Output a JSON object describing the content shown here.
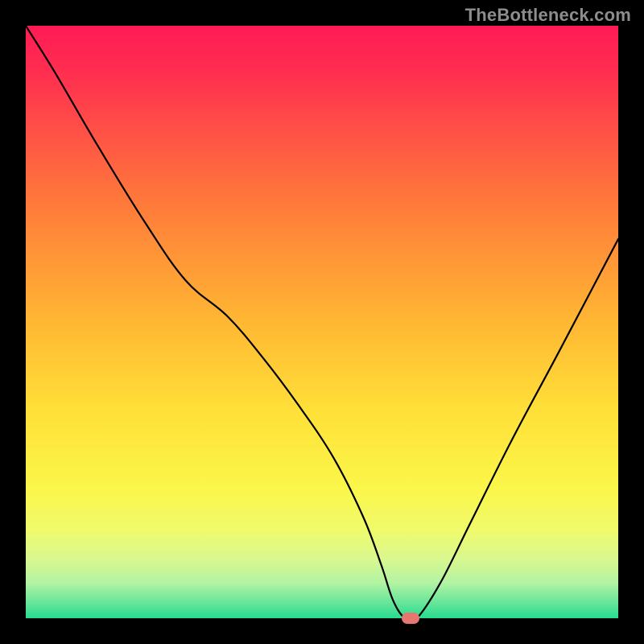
{
  "watermark": {
    "text": "TheBottleneck.com"
  },
  "chart_data": {
    "type": "line",
    "title": "",
    "xlabel": "",
    "ylabel": "",
    "xlim": [
      0,
      100
    ],
    "ylim": [
      0,
      100
    ],
    "background": {
      "type": "vertical-gradient",
      "stops": [
        {
          "offset": 0.0,
          "color": "#ff1a55"
        },
        {
          "offset": 0.08,
          "color": "#ff2f50"
        },
        {
          "offset": 0.3,
          "color": "#ff7a3a"
        },
        {
          "offset": 0.5,
          "color": "#ffb733"
        },
        {
          "offset": 0.65,
          "color": "#ffe038"
        },
        {
          "offset": 0.78,
          "color": "#fbf64a"
        },
        {
          "offset": 0.85,
          "color": "#f0fa6b"
        },
        {
          "offset": 0.9,
          "color": "#d9f88f"
        },
        {
          "offset": 0.94,
          "color": "#b3f3a3"
        },
        {
          "offset": 0.975,
          "color": "#63e59a"
        },
        {
          "offset": 1.0,
          "color": "#27db8e"
        }
      ]
    },
    "series": [
      {
        "name": "bottleneck-curve",
        "color": "#000000",
        "x": [
          0,
          5,
          12,
          20,
          27,
          34,
          40,
          46,
          52,
          57,
          60,
          62,
          64,
          66,
          70,
          75,
          82,
          90,
          100
        ],
        "y": [
          100,
          92,
          80,
          67,
          57,
          51,
          44,
          36,
          27,
          17,
          9,
          3,
          0,
          0,
          6,
          16,
          30,
          45,
          64
        ]
      }
    ],
    "marker": {
      "x": 65,
      "y": 0,
      "color": "#e67670",
      "shape": "pill"
    },
    "grid": false,
    "legend": false
  }
}
